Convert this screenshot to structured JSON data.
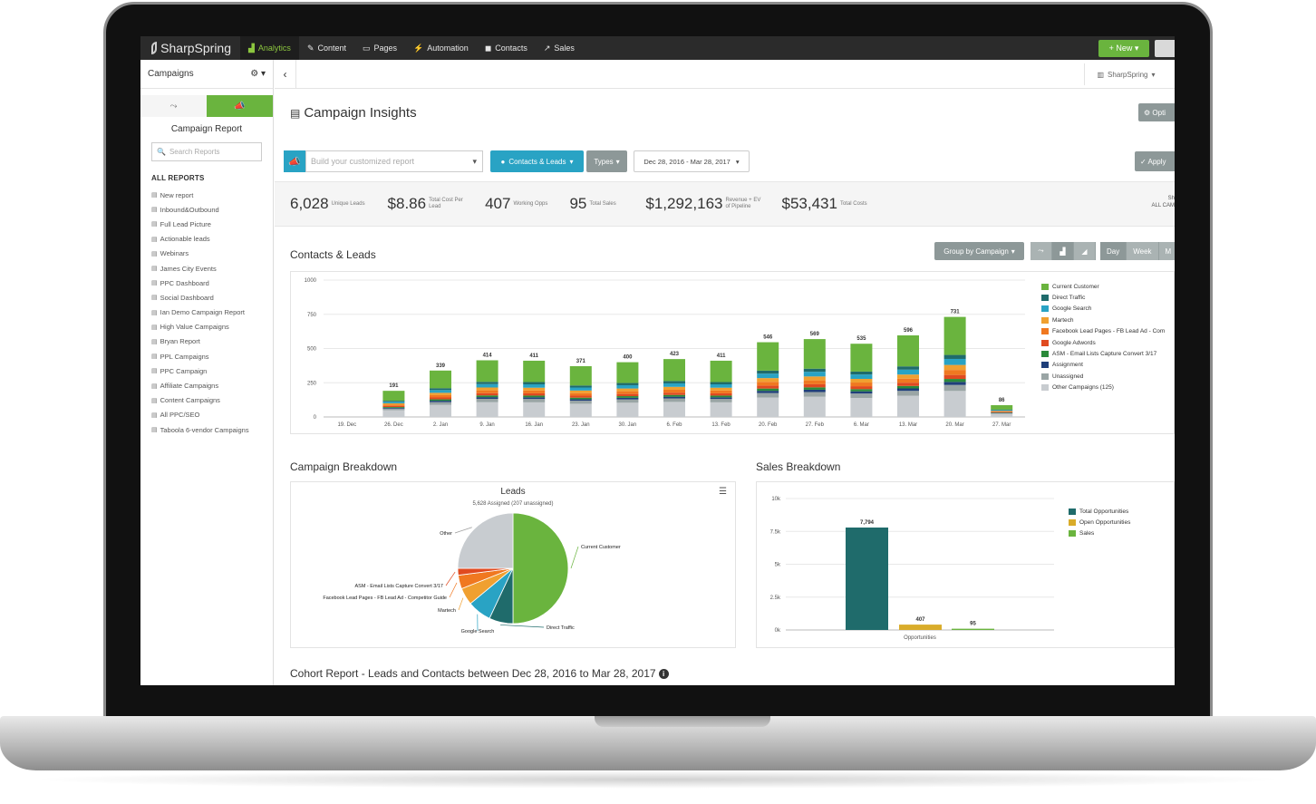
{
  "nav": {
    "logo": "SharpSpring",
    "items": [
      {
        "label": "Analytics",
        "icon": "▟"
      },
      {
        "label": "Content",
        "icon": "✎"
      },
      {
        "label": "Pages",
        "icon": "▭"
      },
      {
        "label": "Automation",
        "icon": "⚡"
      },
      {
        "label": "Contacts",
        "icon": "◼"
      },
      {
        "label": "Sales",
        "icon": "↗"
      }
    ],
    "new_label": "+ New ▾"
  },
  "sidebar": {
    "header": "Campaigns",
    "gear": "⚙ ▾",
    "title": "Campaign Report",
    "search_placeholder": "Search Reports",
    "section": "ALL REPORTS",
    "reports": [
      "New report",
      "Inbound&Outbound",
      "Full Lead Picture",
      "Actionable leads",
      "Webinars",
      "James City Events",
      "PPC Dashboard",
      "Social Dashboard",
      "Ian Demo Campaign Report",
      "High Value Campaigns",
      "Bryan Report",
      "PPL Campaigns",
      "PPC Campaign",
      "Affiliate Campaigns",
      "Content Campaigns",
      "All PPC/SEO",
      "Taboola 6-vendor Campaigns"
    ]
  },
  "header": {
    "back": "‹",
    "account": "SharpSpring",
    "title": "Campaign Insights",
    "options": "⚙ Opti"
  },
  "filters": {
    "build_placeholder": "Build your customized report",
    "contacts_leads": "Contacts & Leads",
    "types": "Types",
    "date_range": "Dec 28, 2016 - Mar 28, 2017",
    "apply": "✓ Apply"
  },
  "stats": [
    {
      "value": "6,028",
      "label": "Unique Leads"
    },
    {
      "value": "$8.86",
      "label": "Total Cost Per Lead"
    },
    {
      "value": "407",
      "label": "Working Opps"
    },
    {
      "value": "95",
      "label": "Total Sales"
    },
    {
      "value": "$1,292,163",
      "label": "Revenue + EV of Pipeline"
    },
    {
      "value": "$53,431",
      "label": "Total Costs"
    }
  ],
  "stats_right": {
    "line1": "Sh",
    "line2": "ALL CAM"
  },
  "contacts_section": {
    "title": "Contacts & Leads",
    "group_by": "Group by Campaign",
    "periods": [
      "Day",
      "Week",
      "M"
    ]
  },
  "colors": {
    "current_customer": "#6ab43e",
    "direct_traffic": "#1f6b6b",
    "google_search": "#29a3c4",
    "martech": "#f0a030",
    "facebook": "#f07820",
    "google_adwords": "#e04a20",
    "asm": "#2a8a3a",
    "assignment": "#1f3f7a",
    "unassigned": "#9aa5a5",
    "other": "#c8ccd0"
  },
  "chart_data": [
    {
      "type": "bar",
      "stacked": true,
      "categories": [
        "19. Dec",
        "26. Dec",
        "2. Jan",
        "9. Jan",
        "16. Jan",
        "23. Jan",
        "30. Jan",
        "6. Feb",
        "13. Feb",
        "20. Feb",
        "27. Feb",
        "6. Mar",
        "13. Mar",
        "20. Mar",
        "27. Mar"
      ],
      "totals": [
        0,
        191,
        339,
        414,
        411,
        371,
        400,
        423,
        411,
        546,
        569,
        535,
        596,
        731,
        86
      ],
      "total_labels": [
        "",
        "191",
        "339",
        "414",
        "411",
        "371",
        "400",
        "423",
        "411",
        "546",
        "569",
        "535",
        "596",
        "731",
        "86"
      ],
      "series_names": [
        "Current Customer",
        "Direct Traffic",
        "Google Search",
        "Martech",
        "Facebook Lead Pages - FB Lead Ad - Com",
        "Google Adwords",
        "ASM - Email Lists Capture Convert 3/17",
        "Assignment",
        "Unassigned",
        "Other Campaigns (125)"
      ],
      "shares": [
        0.38,
        0.04,
        0.06,
        0.05,
        0.05,
        0.04,
        0.03,
        0.03,
        0.06,
        0.26
      ],
      "ylim": [
        0,
        1000
      ],
      "yticks": [
        "0",
        "250",
        "500",
        "750",
        "1000"
      ],
      "legend": "right"
    },
    {
      "type": "pie",
      "title": "Leads",
      "subtitle": "5,628 Assigned (207 unassigned)",
      "labels": [
        "Current Customer",
        "Direct Traffic",
        "Google Search",
        "Martech",
        "Facebook Lead Pages - FB Lead Ad - Competitor Guide",
        "ASM - Email Lists Capture Convert 3/17",
        "Other"
      ],
      "values": [
        50,
        7,
        7,
        5,
        4,
        2,
        25
      ]
    },
    {
      "type": "bar",
      "categories": [
        "Opportunities"
      ],
      "series": [
        {
          "name": "Total Opportunities",
          "values": [
            7794
          ]
        },
        {
          "name": "Open Opportunities",
          "values": [
            407
          ]
        },
        {
          "name": "Sales",
          "values": [
            95
          ]
        }
      ],
      "data_labels": [
        "7,794",
        "407",
        "95"
      ],
      "yticks": [
        "0k",
        "2.5k",
        "5k",
        "7.5k",
        "10k"
      ],
      "ylim": [
        0,
        10000
      ],
      "legend": "right"
    }
  ],
  "campaign_breakdown": {
    "title": "Campaign Breakdown",
    "menu": "☰"
  },
  "sales_breakdown": {
    "title": "Sales Breakdown"
  },
  "cohort": {
    "title": "Cohort Report - Leads and Contacts between Dec 28, 2016 to Mar 28, 2017",
    "info": "i"
  }
}
